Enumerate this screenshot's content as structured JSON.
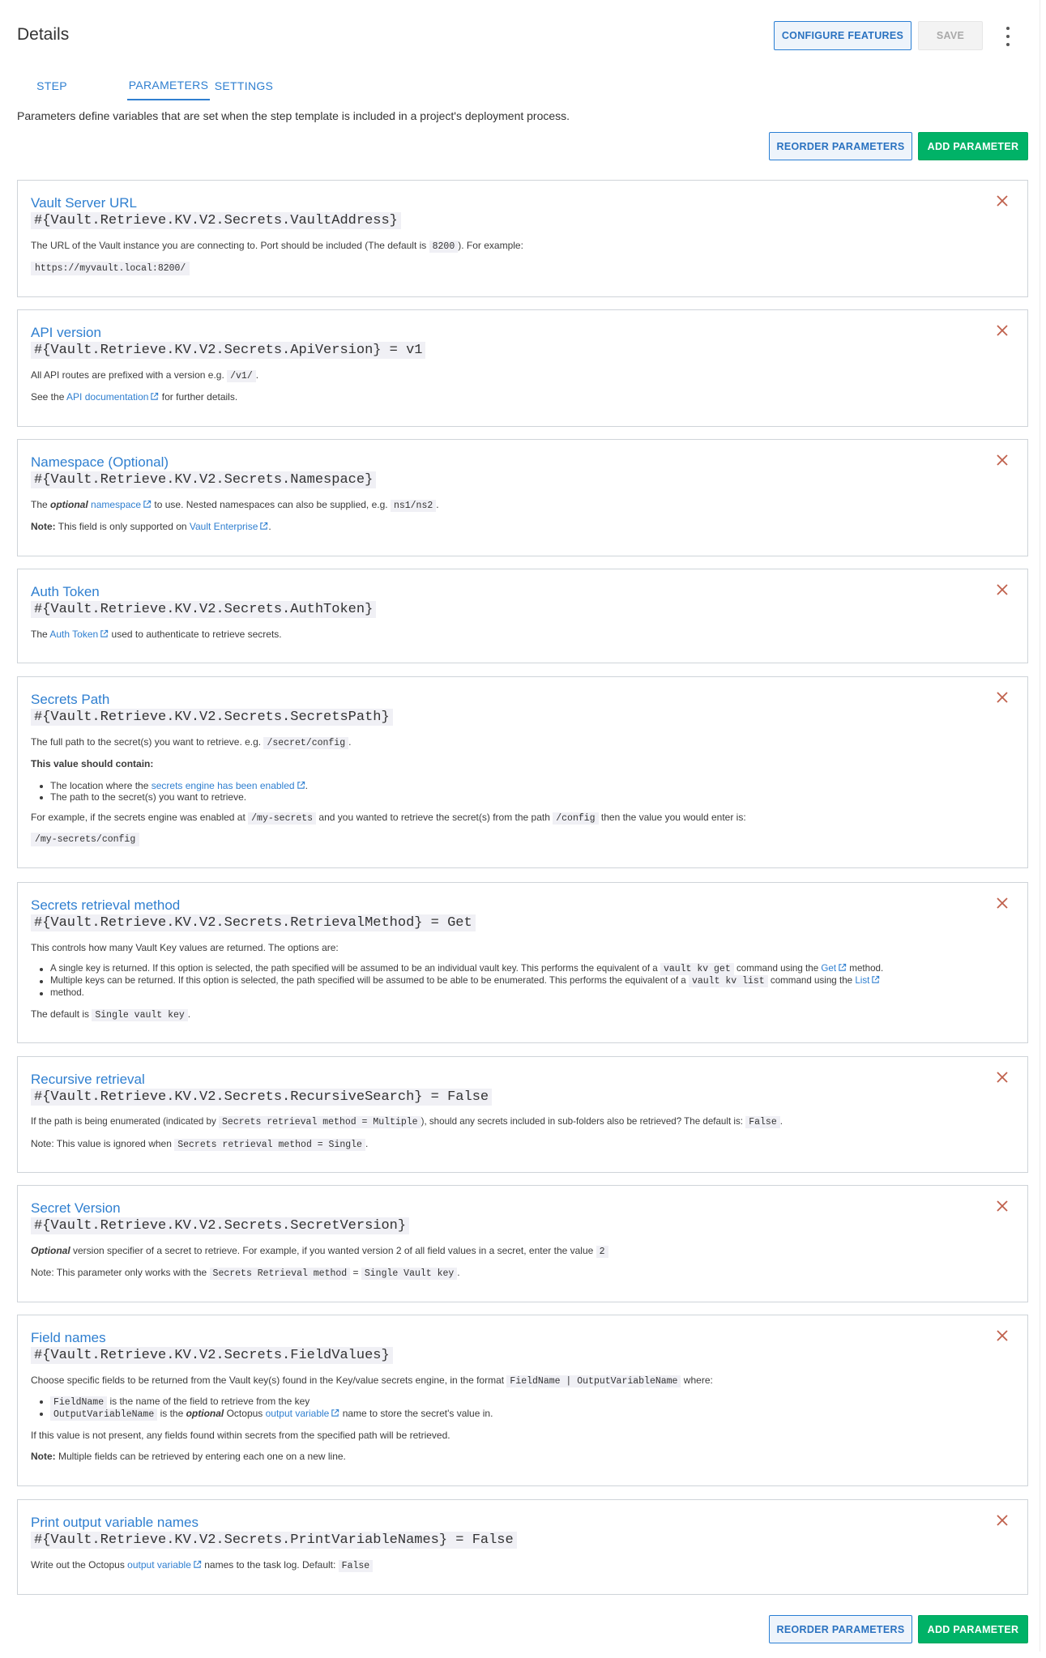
{
  "header": {
    "title": "Details",
    "configure_label": "CONFIGURE FEATURES",
    "save_label": "SAVE"
  },
  "tabs": [
    {
      "label": "STEP"
    },
    {
      "label": "PARAMETERS"
    },
    {
      "label": "SETTINGS"
    }
  ],
  "active_tab": "PARAMETERS",
  "intro": "Parameters define variables that are set when the step template is included in a project's deployment process.",
  "actions": {
    "reorder_label": "REORDER PARAMETERS",
    "add_label": "ADD PARAMETER"
  },
  "colors": {
    "accent": "#2f7fd0",
    "primary_green": "#00b267",
    "remove_red": "#c0614d"
  },
  "icons": {
    "remove": "close-icon",
    "external_link": "external-link-icon",
    "more": "kebab-menu-icon"
  },
  "params": [
    {
      "title": "Vault Server URL",
      "variable": "#{Vault.Retrieve.KV.V2.Secrets.VaultAddress}",
      "desc1_a": "The URL of the Vault instance you are connecting to. Port should be included (The default is ",
      "desc1_code": "8200",
      "desc1_b": "). For example:",
      "example": "https://myvault.local:8200/"
    },
    {
      "title": "API version",
      "variable": "#{Vault.Retrieve.KV.V2.Secrets.ApiVersion} = v1",
      "desc1_a": "All API routes are prefixed with a version e.g. ",
      "desc1_code": "/v1/",
      "desc1_b": ".",
      "desc2_a": "See the ",
      "desc2_link": "API documentation",
      "desc2_b": " for further details."
    },
    {
      "title": "Namespace (Optional)",
      "variable": "#{Vault.Retrieve.KV.V2.Secrets.Namespace}",
      "desc1_a": "The ",
      "desc1_em": "optional",
      "desc1_link": "namespace",
      "desc1_b": " to use. Nested namespaces can also be supplied, e.g. ",
      "desc1_code": "ns1/ns2",
      "desc1_c": ".",
      "desc2_bold": "Note:",
      "desc2_a": " This field is only supported on ",
      "desc2_link": "Vault Enterprise",
      "desc2_b": "."
    },
    {
      "title": "Auth Token",
      "variable": "#{Vault.Retrieve.KV.V2.Secrets.AuthToken}",
      "desc1_a": "The ",
      "desc1_link": "Auth Token",
      "desc1_b": " used to authenticate to retrieve secrets."
    },
    {
      "title": "Secrets Path",
      "variable": "#{Vault.Retrieve.KV.V2.Secrets.SecretsPath}",
      "desc1_a": "The full path to the secret(s) you want to retrieve. e.g. ",
      "desc1_code": "/secret/config",
      "desc1_b": ".",
      "contain_bold": "This value should contain:",
      "bullet1_a": "The location where the ",
      "bullet1_link": "secrets engine has been enabled",
      "bullet1_b": ".",
      "bullet2": "The path to the secret(s) you want to retrieve.",
      "desc3_a": "For example, if the secrets engine was enabled at ",
      "desc3_code1": "/my-secrets",
      "desc3_b": " and you wanted to retrieve the secret(s) from the path ",
      "desc3_code2": "/config",
      "desc3_c": " then the value you would enter is:",
      "example": "/my-secrets/config"
    },
    {
      "title": "Secrets retrieval method",
      "variable": "#{Vault.Retrieve.KV.V2.Secrets.RetrievalMethod} = Get",
      "desc1": "This controls how many Vault Key values are returned. The options are:",
      "bullet1_a": "A single key is returned. If this option is selected, the path specified will be assumed to be an individual vault key. This performs the equivalent of a ",
      "bullet1_code": "vault kv get",
      "bullet1_b": " command using the ",
      "bullet1_link": "Get",
      "bullet1_c": " method.",
      "bullet2_a": "Multiple keys can be returned. If this option is selected, the path specified will be assumed to be able to be enumerated. This performs the equivalent of a ",
      "bullet2_code": "vault kv list",
      "bullet2_b": " command using the ",
      "bullet2_link": "List",
      "bullet2_c": "method.",
      "desc3_a": "The default is ",
      "desc3_code": "Single vault key",
      "desc3_b": "."
    },
    {
      "title": "Recursive retrieval",
      "variable": "#{Vault.Retrieve.KV.V2.Secrets.RecursiveSearch} = False",
      "desc1_a": "If the path is being enumerated (indicated by ",
      "desc1_code": "Secrets retrieval method = Multiple",
      "desc1_b": "), should any secrets included in sub-folders also be retrieved? The default is: ",
      "desc1_code2": "False",
      "desc1_c": ".",
      "desc2_a": "Note: This value is ignored when ",
      "desc2_code": "Secrets retrieval method = Single",
      "desc2_b": "."
    },
    {
      "title": "Secret Version",
      "variable": "#{Vault.Retrieve.KV.V2.Secrets.SecretVersion}",
      "desc1_em": "Optional",
      "desc1_a": " version specifier of a secret to retrieve. For example, if you wanted version 2 of all field values in a secret, enter the value ",
      "desc1_code": "2",
      "desc2_a": "Note: This parameter only works with the ",
      "desc2_code": "Secrets Retrieval method",
      "desc2_b": " = ",
      "desc2_code2": "Single Vault key",
      "desc2_c": "."
    },
    {
      "title": "Field names",
      "variable": "#{Vault.Retrieve.KV.V2.Secrets.FieldValues}",
      "desc1_a": "Choose specific fields to be returned from the Vault key(s) found in the Key/value secrets engine, in the format ",
      "desc1_code": "FieldName | OutputVariableName",
      "desc1_b": " where:",
      "bullet1_code": "FieldName",
      "bullet1_a": " is the name of the field to retrieve from the key",
      "bullet2_code": "OutputVariableName",
      "bullet2_a": " is the ",
      "bullet2_em": "optional",
      "bullet2_b": " Octopus ",
      "bullet2_link": "output variable",
      "bullet2_c": " name to store the secret's value in.",
      "desc3": "If this value is not present, any fields found within secrets from the specified path will be retrieved.",
      "desc4_bold": "Note:",
      "desc4_a": " Multiple fields can be retrieved by entering each one on a new line."
    },
    {
      "title": "Print output variable names",
      "variable": "#{Vault.Retrieve.KV.V2.Secrets.PrintVariableNames} = False",
      "desc1_a": "Write out the Octopus ",
      "desc1_link": "output variable",
      "desc1_b": " names to the task log. Default: ",
      "desc1_code": "False"
    }
  ]
}
